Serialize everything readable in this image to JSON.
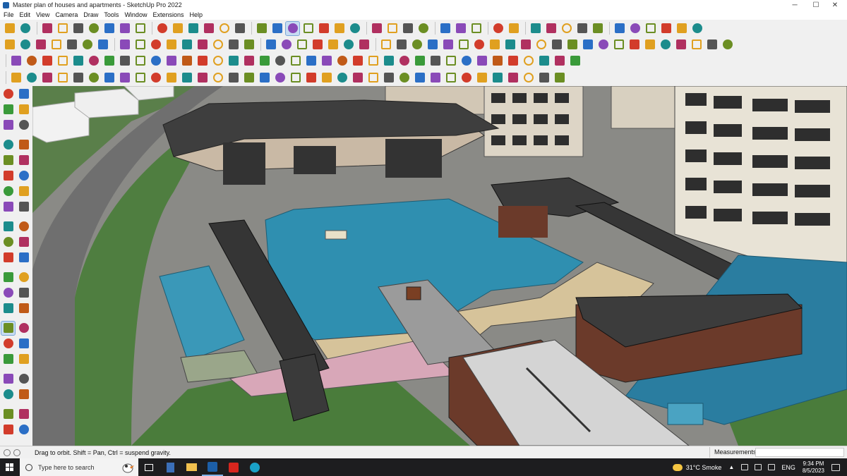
{
  "window": {
    "title": "Master plan of houses and apartments - SketchUp Pro 2022",
    "controls": {
      "minimize": "─",
      "maximize": "☐",
      "close": "✕"
    }
  },
  "menubar": {
    "items": [
      "File",
      "Edit",
      "View",
      "Camera",
      "Draw",
      "Tools",
      "Window",
      "Extensions",
      "Help"
    ]
  },
  "toolbars": {
    "row1": {
      "icon_count": 42,
      "active_tool": "orbit"
    },
    "row2": {
      "icon_count": 46
    },
    "row2b": {
      "icon_count": 37
    },
    "row3": {
      "icon_count": 36
    }
  },
  "left_toolbar": {
    "tools": [
      [
        "select-tool",
        "component-tool"
      ],
      [
        "paint-bucket-tool",
        "eraser-tool"
      ],
      [
        "tag-tool",
        "tape-tool"
      ],
      [
        "line-tool",
        "freehand-tool"
      ],
      [
        "rectangle-tool",
        "rotated-rectangle-tool"
      ],
      [
        "circle-tool",
        "polygon-tool"
      ],
      [
        "arc-tool",
        "pie-tool"
      ],
      [
        "offset-tool",
        "follow-me-tool"
      ],
      [
        "move-tool",
        "push-pull-tool"
      ],
      [
        "rotate-tool",
        "follow-me-alt-tool"
      ],
      [
        "scale-tool",
        "offset-alt-tool"
      ],
      [
        "tape-measure-tool",
        "text-tool"
      ],
      [
        "protractor-tool",
        "axes-tool"
      ],
      [
        "dimension-tool",
        "3d-text-tool"
      ],
      [
        "orbit-tool",
        "pan-tool"
      ],
      [
        "zoom-tool",
        "zoom-window-tool"
      ],
      [
        "zoom-extents-tool",
        "previous-view-tool"
      ],
      [
        "position-camera-tool",
        "look-around-tool"
      ],
      [
        "walk-tool",
        "section-plane-tool"
      ],
      [
        "warehouse-tool",
        "extension-tool"
      ],
      [
        "layout-tool",
        "styles-tool"
      ]
    ],
    "active_tool": "orbit-tool"
  },
  "statusbar": {
    "hint": "Drag to orbit. Shift = Pan, Ctrl = suspend gravity.",
    "measurements_label": "Measurements",
    "measurements_value": ""
  },
  "taskbar": {
    "search_placeholder": "Type here to search",
    "weather": "31°C  Smoke",
    "language": "ENG",
    "time": "9:34 PM",
    "date": "8/5/2023",
    "apps": [
      "task-view",
      "calculator",
      "file-explorer",
      "sketchup",
      "acrobat",
      "edge"
    ]
  },
  "colors": {
    "pool": "#2f8fb0",
    "grass": "#4c7a3c",
    "roof": "#3c3c3c",
    "brick": "#6b3a2a",
    "facade": "#e6e0d2",
    "deck": "#d6c39a"
  }
}
